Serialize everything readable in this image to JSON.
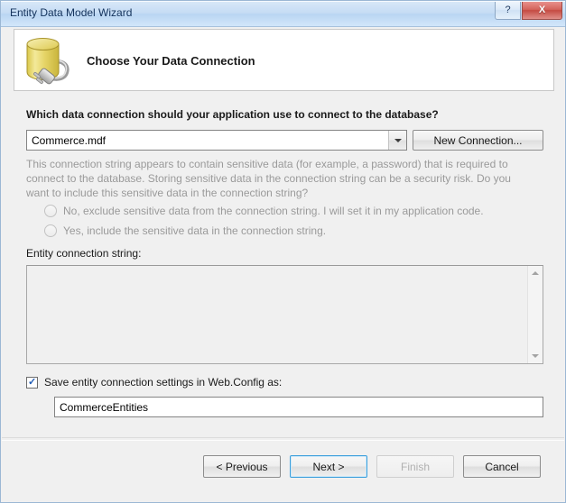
{
  "window": {
    "title": "Entity Data Model Wizard",
    "help_label": "?",
    "close_label": "X"
  },
  "header": {
    "title": "Choose Your Data Connection",
    "icon": "database-connection-icon"
  },
  "main": {
    "question_label": "Which data connection should your application use to connect to the database?",
    "connection_combo": {
      "value": "Commerce.mdf",
      "arrow_icon": "chevron-down-icon"
    },
    "new_connection_label": "New Connection...",
    "sensitive_note": "This connection string appears to contain sensitive data (for example, a password) that is required to connect to the database. Storing sensitive data in the connection string can be a security risk. Do you want to include this sensitive data in the connection string?",
    "radio_options": [
      {
        "label": "No, exclude sensitive data from the connection string. I will set it in my application code.",
        "selected": false,
        "disabled": true
      },
      {
        "label": "Yes, include the sensitive data in the connection string.",
        "selected": false,
        "disabled": true
      }
    ],
    "entity_connection_string_label": "Entity connection string:",
    "entity_connection_string_value": "",
    "scrollbar": {
      "up_icon": "scroll-up-arrow-icon",
      "down_icon": "scroll-down-arrow-icon"
    },
    "save_checkbox": {
      "label": "Save entity connection settings in Web.Config as:",
      "checked": true,
      "check_glyph": "✓"
    },
    "save_name_value": "CommerceEntities"
  },
  "footer": {
    "buttons": [
      {
        "label": "< Previous",
        "state": "enabled"
      },
      {
        "label": "Next >",
        "state": "default"
      },
      {
        "label": "Finish",
        "state": "disabled"
      },
      {
        "label": "Cancel",
        "state": "enabled"
      }
    ]
  },
  "colors": {
    "titlebar": "#c5dcf4",
    "body": "#f0f0f0",
    "accent_focus": "#3c9fdc",
    "close_button": "#c44b42",
    "disabled_text": "#9a9a9a",
    "icon_cylinder": "#e8d96a"
  }
}
